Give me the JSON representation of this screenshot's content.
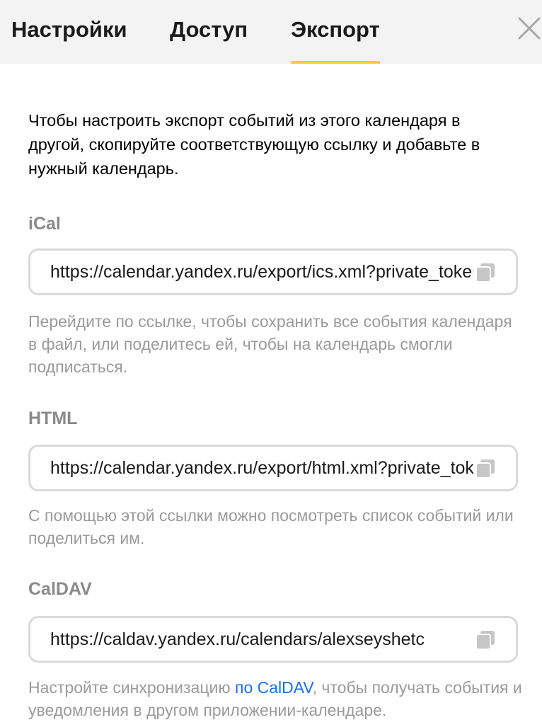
{
  "tabs": {
    "settings": "Настройки",
    "access": "Доступ",
    "export": "Экспорт",
    "active": "export"
  },
  "intro_text": "Чтобы настроить экспорт событий из этого календаря в другой, скопируйте соответствующую ссылку и добавьте в нужный календарь.",
  "ical": {
    "label": "iCal",
    "url": "https://calendar.yandex.ru/export/ics.xml?private_token",
    "help": "Перейдите по ссылке, чтобы сохранить все события календаря в файл, или поделитесь ей, чтобы на календарь смогли подписаться."
  },
  "html": {
    "label": "HTML",
    "url": "https://calendar.yandex.ru/export/html.xml?private_token",
    "help": "С помощью этой ссылки можно посмотреть список событий или поделиться им."
  },
  "caldav": {
    "label": "CalDAV",
    "url": "https://caldav.yandex.ru/calendars/alexseyshetc",
    "help_before": "Настройте синхронизацию ",
    "help_link": "по CalDAV",
    "help_after": ", чтобы получать события и уведомления в другом приложении-календаре."
  },
  "icons": {
    "close": "close-icon",
    "copy": "copy-icon"
  },
  "colors": {
    "accent_underline": "#ffcc33",
    "link": "#1b6fe8",
    "header_bg": "#f3f3f3",
    "muted_text": "#9a9a9a"
  }
}
